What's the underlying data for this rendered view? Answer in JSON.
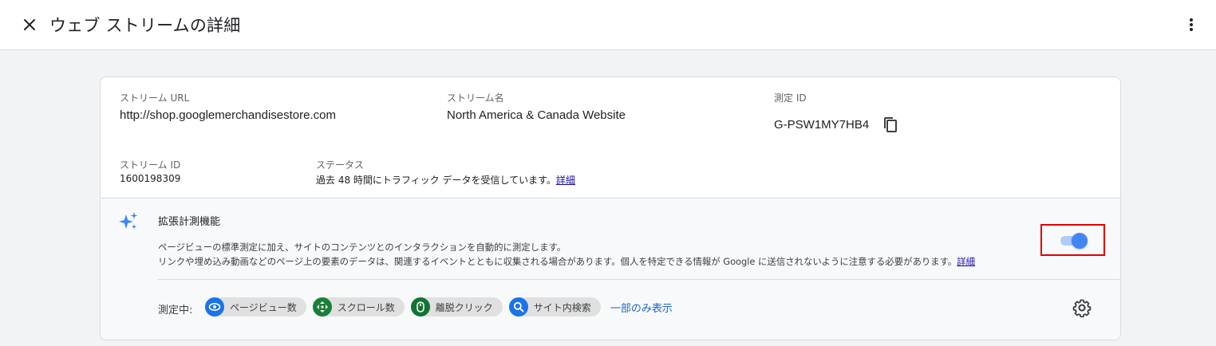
{
  "header": {
    "title": "ウェブ ストリームの詳細",
    "close_icon": "close-icon",
    "more_icon": "more-vert-icon"
  },
  "stream": {
    "url_label": "ストリーム URL",
    "url_value": "http://shop.googlemerchandisestore.com",
    "name_label": "ストリーム名",
    "name_value": "North America & Canada Website",
    "measurement_id_label": "測定 ID",
    "measurement_id_value": "G-PSW1MY7HB4",
    "id_label": "ストリーム ID",
    "id_value": "1600198309",
    "status_label": "ステータス",
    "status_value": "過去 48 時間にトラフィック データを受信しています。",
    "status_link": "詳細"
  },
  "enhanced": {
    "title": "拡張計測機能",
    "desc_line1": "ページビューの標準測定に加え、サイトのコンテンツとのインタラクションを自動的に測定します。",
    "desc_line2": "リンクや埋め込み動画などのページ上の要素のデータは、関連するイベントとともに収集される場合があります。個人を特定できる情報が Google に送信されないように注意する必要があります。",
    "desc_link": "詳細",
    "toggle_on": true,
    "measuring_label": "測定中:",
    "chips": [
      {
        "label": "ページビュー数",
        "icon": "eye-icon",
        "color": "#1a73e8"
      },
      {
        "label": "スクロール数",
        "icon": "scroll-icon",
        "color": "#188038"
      },
      {
        "label": "離脱クリック",
        "icon": "mouse-icon",
        "color": "#137333"
      },
      {
        "label": "サイト内検索",
        "icon": "search-icon",
        "color": "#1a73e8"
      }
    ],
    "show_partial": "一部のみ表示"
  },
  "colors": {
    "accent": "#1a73e8",
    "highlight_border": "#e00000",
    "link": "#1a0dab"
  }
}
